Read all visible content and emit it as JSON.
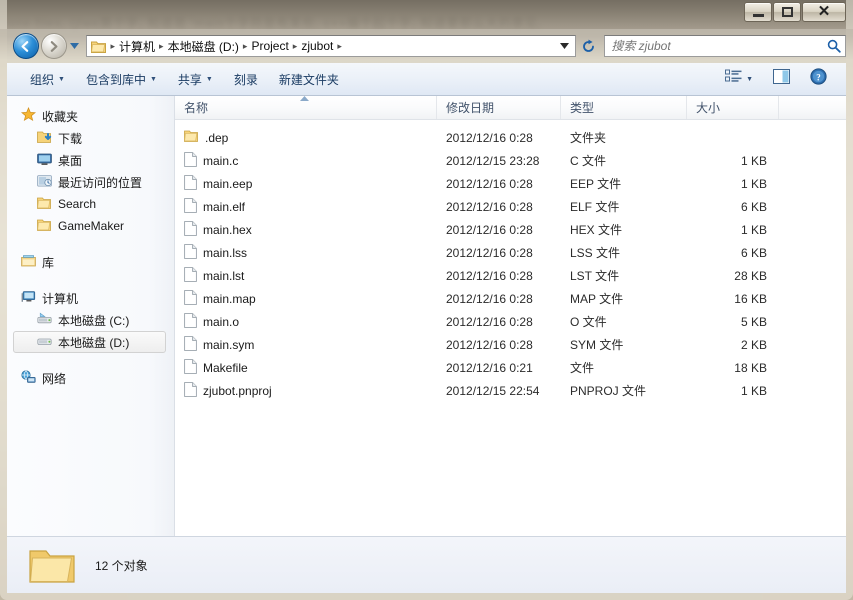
{
  "window": {
    "background_blur_text": "one files, (jlwe算个字, 知道是 'main个字符是有某些, c++编个起个字, 知道要那么大的意见,",
    "controls": {
      "minimize": "minimize-button",
      "maximize": "maximize-button",
      "close": "close-button"
    }
  },
  "nav": {
    "back_label": "←",
    "forward_label": "→",
    "history_caret": "▼",
    "refresh_label": "↻",
    "breadcrumbs": [
      "计算机",
      "本地磁盘 (D:)",
      "Project",
      "zjubot"
    ],
    "separator": "▸",
    "address_caret": "▼"
  },
  "search": {
    "placeholder": "搜索 zjubot",
    "value": "",
    "icon": "search-icon"
  },
  "toolbar": {
    "items": [
      {
        "label": "组织",
        "caret": "▼"
      },
      {
        "label": "包含到库中",
        "caret": "▼"
      },
      {
        "label": "共享",
        "caret": "▼"
      },
      {
        "label": "刻录",
        "caret": ""
      },
      {
        "label": "新建文件夹",
        "caret": ""
      }
    ],
    "view_caret": "▼",
    "icons": [
      "view-list-icon",
      "preview-pane-icon",
      "help-icon"
    ]
  },
  "sidebar": {
    "groups": [
      {
        "header": {
          "label": "收藏夹",
          "icon": "star-icon"
        },
        "items": [
          {
            "label": "下载",
            "icon": "downloads-icon"
          },
          {
            "label": "桌面",
            "icon": "desktop-icon"
          },
          {
            "label": "最近访问的位置",
            "icon": "recent-places-icon"
          },
          {
            "label": "Search",
            "icon": "folder-icon"
          },
          {
            "label": "GameMaker",
            "icon": "folder-icon"
          }
        ]
      },
      {
        "header": {
          "label": "库",
          "icon": "library-icon"
        },
        "items": []
      },
      {
        "header": {
          "label": "计算机",
          "icon": "computer-icon"
        },
        "items": [
          {
            "label": "本地磁盘 (C:)",
            "icon": "system-drive-icon",
            "selected": false
          },
          {
            "label": "本地磁盘 (D:)",
            "icon": "drive-icon",
            "selected": true
          }
        ]
      },
      {
        "header": {
          "label": "网络",
          "icon": "network-icon"
        },
        "items": []
      }
    ]
  },
  "filelist": {
    "columns": [
      {
        "key": "name",
        "label": "名称",
        "sorted": "asc"
      },
      {
        "key": "date",
        "label": "修改日期",
        "sorted": ""
      },
      {
        "key": "type",
        "label": "类型",
        "sorted": ""
      },
      {
        "key": "size",
        "label": "大小",
        "sorted": ""
      }
    ],
    "rows": [
      {
        "name": ".dep",
        "date": "2012/12/16 0:28",
        "type": "文件夹",
        "size": "",
        "icon": "folder-icon"
      },
      {
        "name": "main.c",
        "date": "2012/12/15 23:28",
        "type": "C 文件",
        "size": "1 KB",
        "icon": "file-icon"
      },
      {
        "name": "main.eep",
        "date": "2012/12/16 0:28",
        "type": "EEP 文件",
        "size": "1 KB",
        "icon": "file-icon"
      },
      {
        "name": "main.elf",
        "date": "2012/12/16 0:28",
        "type": "ELF 文件",
        "size": "6 KB",
        "icon": "file-icon"
      },
      {
        "name": "main.hex",
        "date": "2012/12/16 0:28",
        "type": "HEX 文件",
        "size": "1 KB",
        "icon": "file-icon"
      },
      {
        "name": "main.lss",
        "date": "2012/12/16 0:28",
        "type": "LSS 文件",
        "size": "6 KB",
        "icon": "file-icon"
      },
      {
        "name": "main.lst",
        "date": "2012/12/16 0:28",
        "type": "LST 文件",
        "size": "28 KB",
        "icon": "file-icon"
      },
      {
        "name": "main.map",
        "date": "2012/12/16 0:28",
        "type": "MAP 文件",
        "size": "16 KB",
        "icon": "file-icon"
      },
      {
        "name": "main.o",
        "date": "2012/12/16 0:28",
        "type": "O 文件",
        "size": "5 KB",
        "icon": "file-icon"
      },
      {
        "name": "main.sym",
        "date": "2012/12/16 0:28",
        "type": "SYM 文件",
        "size": "2 KB",
        "icon": "file-icon"
      },
      {
        "name": "Makefile",
        "date": "2012/12/16 0:21",
        "type": "文件",
        "size": "18 KB",
        "icon": "file-icon"
      },
      {
        "name": "zjubot.pnproj",
        "date": "2012/12/15 22:54",
        "type": "PNPROJ 文件",
        "size": "1 KB",
        "icon": "file-icon"
      }
    ]
  },
  "statusbar": {
    "icon": "large-folder-icon",
    "text": "12 个对象"
  },
  "colors": {
    "folder_yellow": "#fbd77a",
    "accent_blue": "#1b5fa8",
    "toolbar_text": "#1b3c63",
    "header_text": "#42536b",
    "selection_border": "#d2d2d2"
  }
}
